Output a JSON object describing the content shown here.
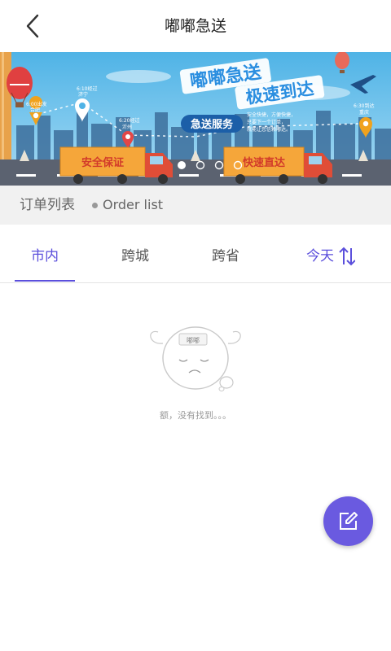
{
  "header": {
    "title": "嘟嘟急送"
  },
  "banner": {
    "headline1": "嘟嘟急送",
    "headline2": "极速到达",
    "service_tag": "急送服务",
    "service_desc": [
      "安全快捷，方便快捷，",
      "只要下一个订单，",
      "就能让您信赖嘟达。"
    ],
    "truck_left_label": "安全保证",
    "truck_right_label": "快速直达",
    "pins": [
      {
        "time": "6:00出发",
        "place": "合肥"
      },
      {
        "time": "6:10经过",
        "place": "济宁"
      },
      {
        "time": "6:20经过",
        "place": "沂州"
      },
      {
        "time": "6:30到达",
        "place": "重庆"
      }
    ],
    "page_dots": 4,
    "active_dot": 0
  },
  "list_header": {
    "label_cn": "订单列表",
    "label_en": "Order list"
  },
  "tabs": [
    {
      "label": "市内",
      "active": true
    },
    {
      "label": "跨城",
      "active": false
    },
    {
      "label": "跨省",
      "active": false
    }
  ],
  "sort": {
    "label": "今天"
  },
  "empty": {
    "badge": "嘟嘟",
    "message": "额，没有找到。。。"
  },
  "colors": {
    "accent": "#5b4fdc",
    "fab": "#6a5ae0"
  }
}
